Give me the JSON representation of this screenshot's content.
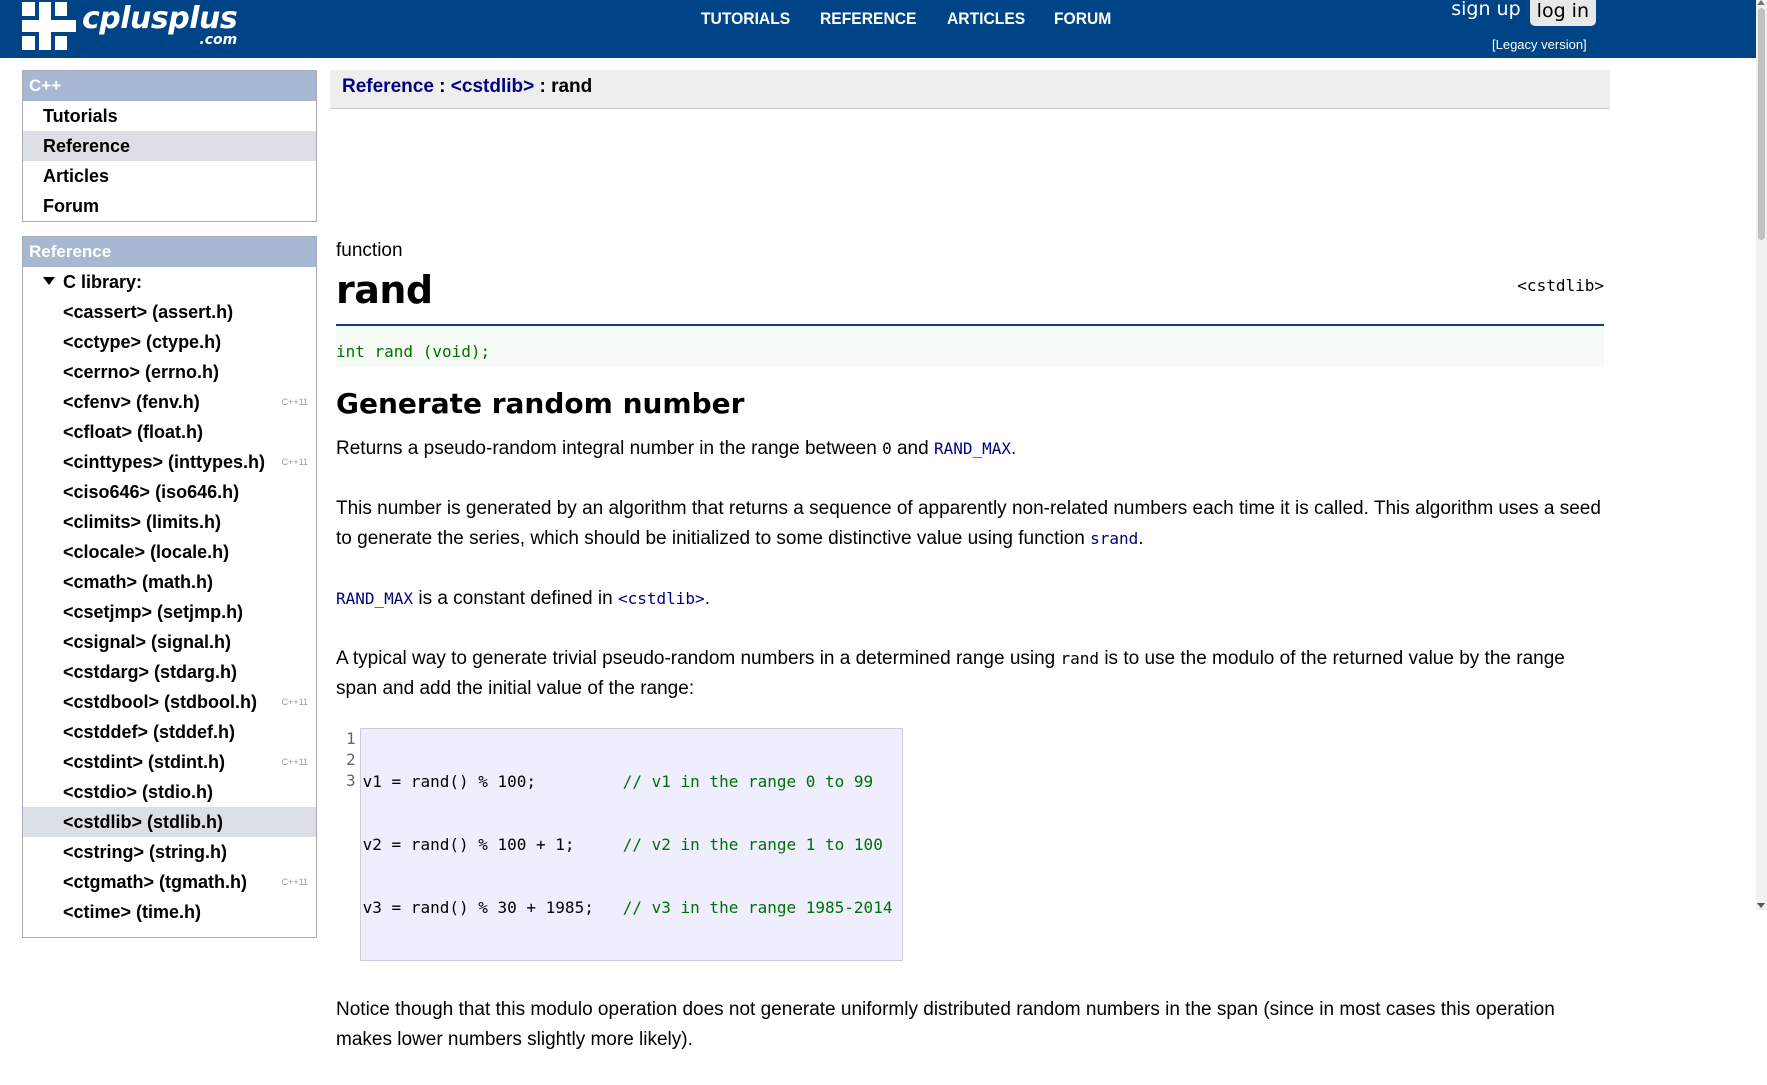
{
  "header": {
    "logo_text": "cplusplus",
    "logo_sub": ".com",
    "nav": [
      "TUTORIALS",
      "REFERENCE",
      "ARTICLES",
      "FORUM"
    ],
    "sign_up": "sign up",
    "log_in": "log in",
    "legacy": "[Legacy version]"
  },
  "sidebar_cpp": {
    "title": "C++",
    "items": [
      "Tutorials",
      "Reference",
      "Articles",
      "Forum"
    ],
    "selected": "Reference"
  },
  "sidebar_ref": {
    "title": "Reference",
    "section": "C library:",
    "libs": [
      {
        "name": "<cassert> (assert.h)",
        "tag": ""
      },
      {
        "name": "<cctype> (ctype.h)",
        "tag": ""
      },
      {
        "name": "<cerrno> (errno.h)",
        "tag": ""
      },
      {
        "name": "<cfenv> (fenv.h)",
        "tag": "C++11"
      },
      {
        "name": "<cfloat> (float.h)",
        "tag": ""
      },
      {
        "name": "<cinttypes> (inttypes.h)",
        "tag": "C++11"
      },
      {
        "name": "<ciso646> (iso646.h)",
        "tag": ""
      },
      {
        "name": "<climits> (limits.h)",
        "tag": ""
      },
      {
        "name": "<clocale> (locale.h)",
        "tag": ""
      },
      {
        "name": "<cmath> (math.h)",
        "tag": ""
      },
      {
        "name": "<csetjmp> (setjmp.h)",
        "tag": ""
      },
      {
        "name": "<csignal> (signal.h)",
        "tag": ""
      },
      {
        "name": "<cstdarg> (stdarg.h)",
        "tag": ""
      },
      {
        "name": "<cstdbool> (stdbool.h)",
        "tag": "C++11"
      },
      {
        "name": "<cstddef> (stddef.h)",
        "tag": ""
      },
      {
        "name": "<cstdint> (stdint.h)",
        "tag": "C++11"
      },
      {
        "name": "<cstdio> (stdio.h)",
        "tag": ""
      },
      {
        "name": "<cstdlib> (stdlib.h)",
        "tag": "",
        "selected": true
      },
      {
        "name": "<cstring> (string.h)",
        "tag": ""
      },
      {
        "name": "<ctgmath> (tgmath.h)",
        "tag": "C++11"
      },
      {
        "name": "<ctime> (time.h)",
        "tag": ""
      }
    ]
  },
  "breadcrumb": {
    "ref": "Reference",
    "sep1": " : ",
    "lib": "<cstdlib> ",
    "sep2": " : ",
    "current": "rand"
  },
  "article": {
    "kind": "function",
    "title": "rand",
    "header_lib": "<cstdlib>",
    "prototype": "int rand (void);",
    "heading": "Generate random number",
    "p1_a": "Returns a pseudo-random integral number in the range between ",
    "p1_zero": "0",
    "p1_b": " and ",
    "p1_link": "RAND_MAX",
    "p1_c": ".",
    "p2_a": "This number is generated by an algorithm that returns a sequence of apparently non-related numbers each time it is called. This algorithm uses a seed to generate the series, which should be initialized to some distinctive value using function ",
    "p2_link": "srand",
    "p2_b": ".",
    "p3_link1": "RAND_MAX",
    "p3_a": " is a constant defined in ",
    "p3_link2": "<cstdlib>",
    "p3_b": ".",
    "p4_a": "A typical way to generate trivial pseudo-random numbers in a determined range using ",
    "p4_code": "rand",
    "p4_b": " is to use the modulo of the returned value by the range span and add the initial value of the range:",
    "code_lines": [
      {
        "n": "1",
        "code": "v1 = rand() % 100;         ",
        "comment": "// v1 in the range 0 to 99"
      },
      {
        "n": "2",
        "code": "v2 = rand() % 100 + 1;     ",
        "comment": "// v2 in the range 1 to 100"
      },
      {
        "n": "3",
        "code": "v3 = rand() % 30 + 1985;   ",
        "comment": "// v3 in the range 1985-2014"
      }
    ],
    "p5": "Notice though that this modulo operation does not generate uniformly distributed random numbers in the span (since in most cases this operation makes lower numbers slightly more likely)."
  },
  "colors": {
    "topbar": "#004488",
    "link": "#000080",
    "code_green": "#007000"
  }
}
